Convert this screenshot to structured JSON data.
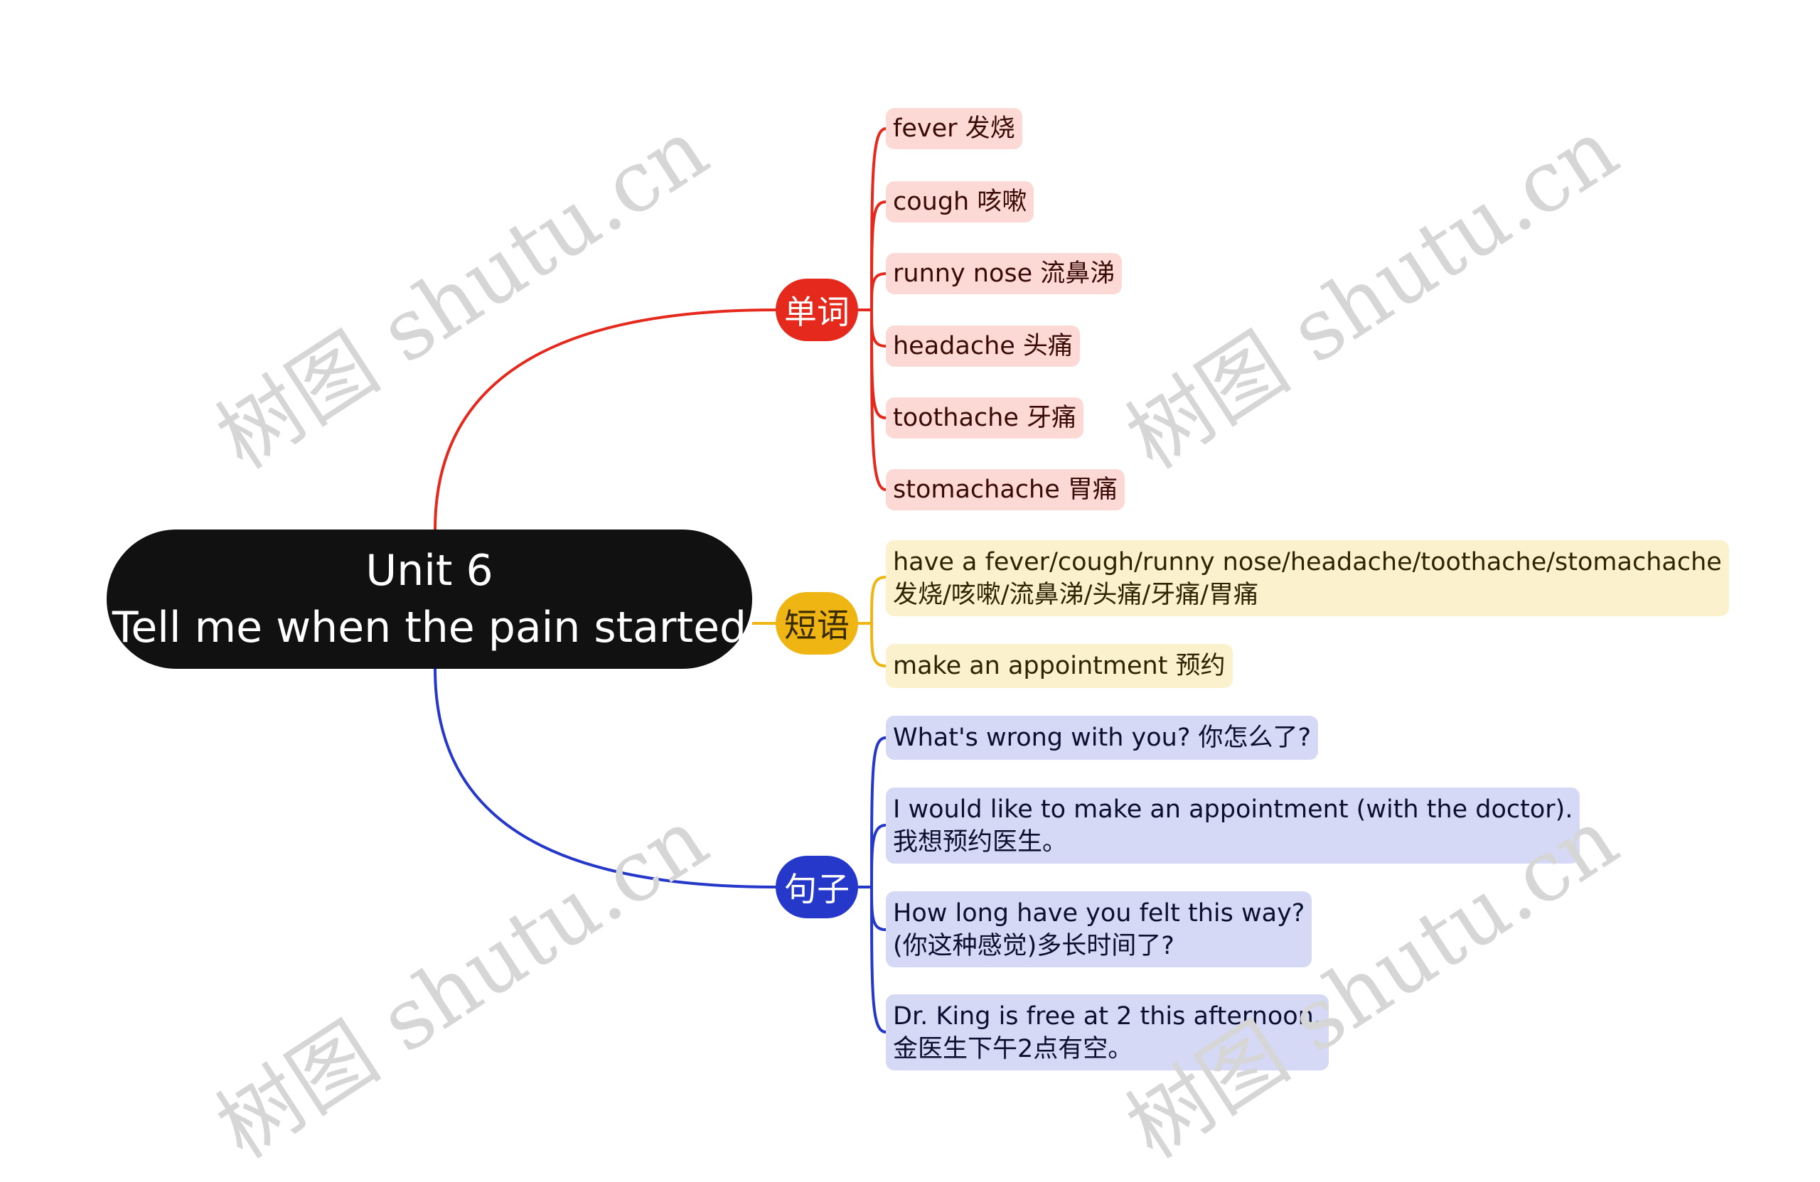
{
  "root": {
    "line1": "Unit 6",
    "line2": "Tell me when the pain started"
  },
  "colors": {
    "root": "#111111",
    "vocab": "#e5291c",
    "phrases": "#efb512",
    "sentences": "#2538c9"
  },
  "branches": [
    {
      "id": "vocab",
      "label": "单词",
      "items": [
        {
          "lines": [
            "fever 发烧"
          ]
        },
        {
          "lines": [
            "cough 咳嗽"
          ]
        },
        {
          "lines": [
            "runny nose 流鼻涕"
          ]
        },
        {
          "lines": [
            "headache 头痛"
          ]
        },
        {
          "lines": [
            "toothache 牙痛"
          ]
        },
        {
          "lines": [
            "stomachache  胃痛"
          ]
        }
      ]
    },
    {
      "id": "phrases",
      "label": "短语",
      "items": [
        {
          "lines": [
            "have a fever/cough/runny nose/headache/toothache/stomachache",
            "发烧/咳嗽/流鼻涕/头痛/牙痛/胃痛"
          ]
        },
        {
          "lines": [
            "make an appointment 预约"
          ]
        }
      ]
    },
    {
      "id": "sentences",
      "label": "句子",
      "items": [
        {
          "lines": [
            "What's wrong with you? 你怎么了?"
          ]
        },
        {
          "lines": [
            "I would like to make an appointment (with the doctor).",
            "我想预约医生。"
          ]
        },
        {
          "lines": [
            "How long have you felt this way?",
            "(你这种感觉)多长时间了?"
          ]
        },
        {
          "lines": [
            "Dr. King is free at 2 this afternoon.",
            "金医生下午2点有空。"
          ]
        }
      ]
    }
  ],
  "watermark": "树图 shutu.cn"
}
